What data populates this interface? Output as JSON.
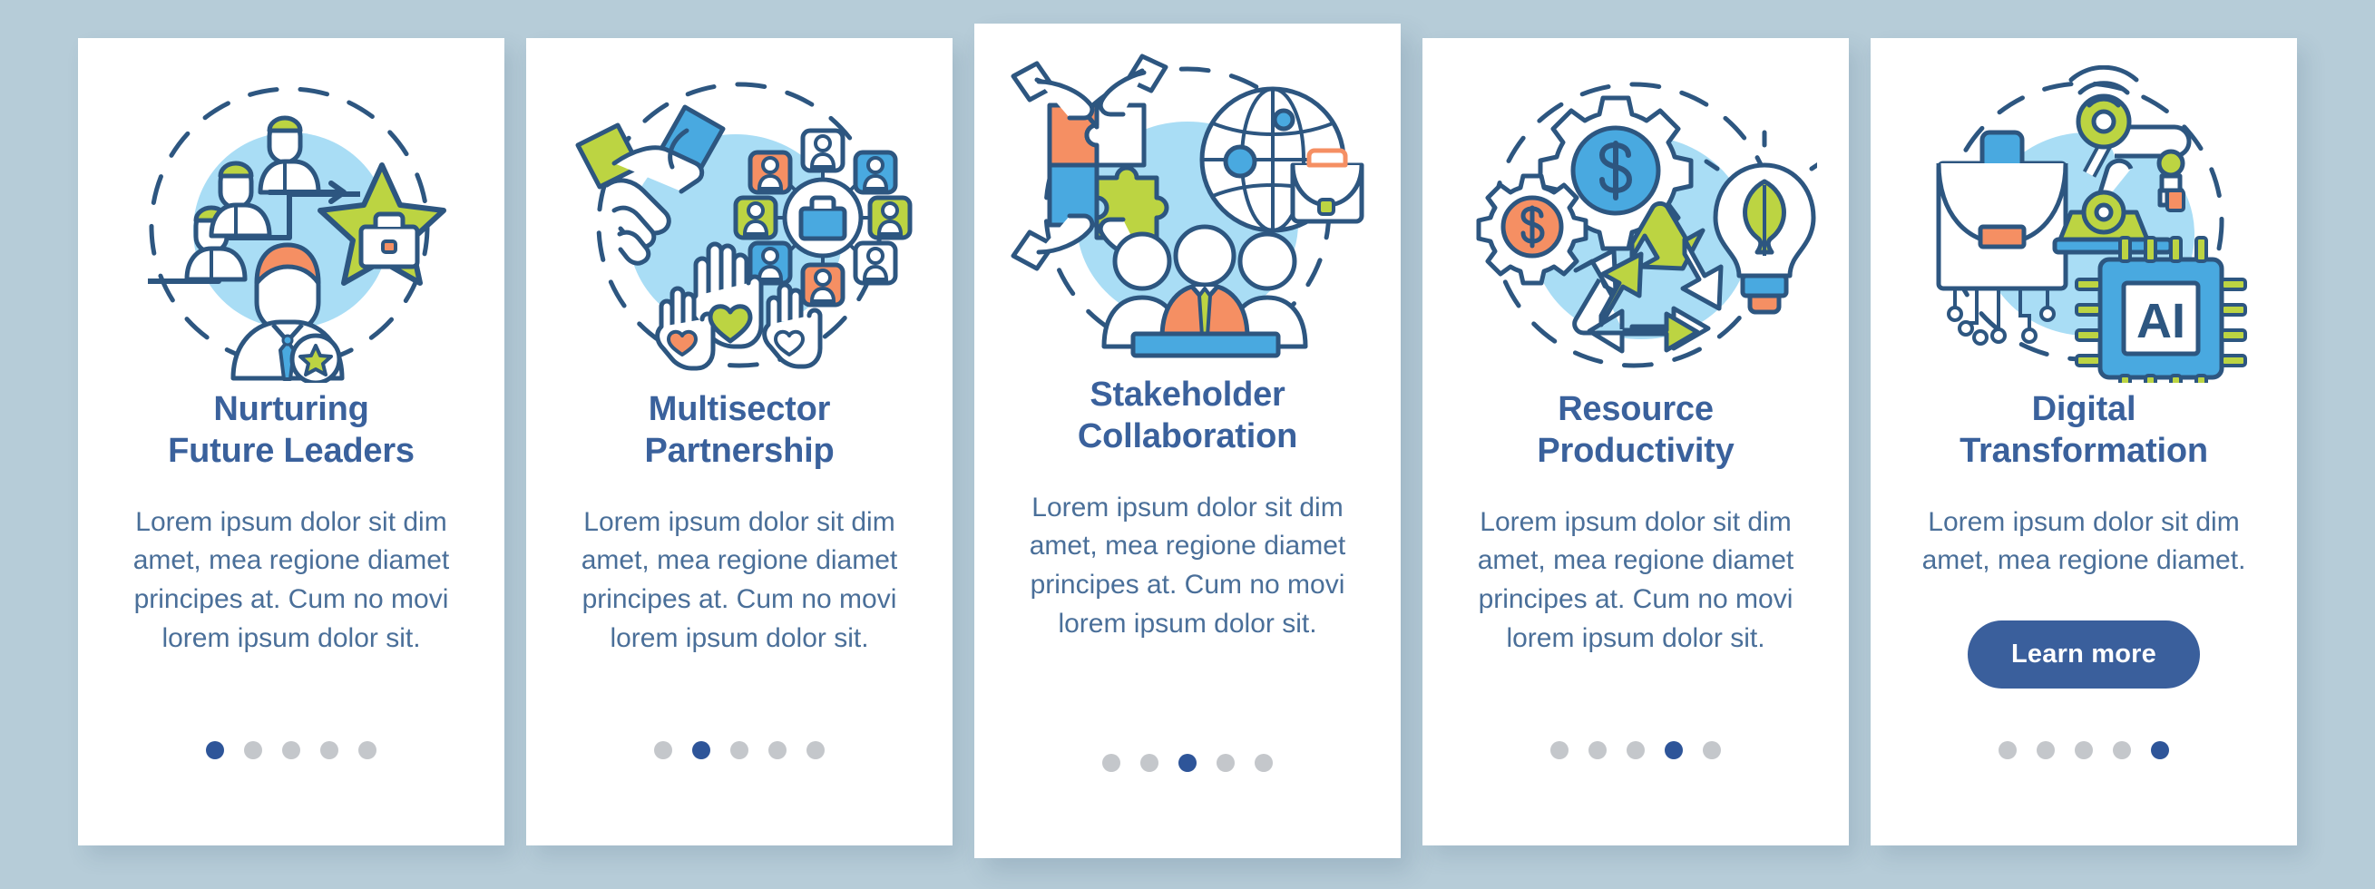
{
  "palette": {
    "page_background": "#b6ccd8",
    "card_background": "#ffffff",
    "title_blue": "#3a619c",
    "body_blue": "#4a6f99",
    "outline_blue": "#2d5680",
    "accent_light_blue": "#a9ddf5",
    "accent_blue": "#49a9e0",
    "accent_olive": "#bcd442",
    "accent_orange": "#f58f63",
    "dot_inactive": "#c4c7cb",
    "dot_active": "#2e5599",
    "button_blue": "#3a5f9c"
  },
  "cards": [
    {
      "id": "nurturing-future-leaders",
      "illustration": "career-growth-leader-icon",
      "title": "Nurturing\nFuture Leaders",
      "body": "Lorem ipsum dolor sit dim amet, mea regione diamet principes at. Cum no movi lorem ipsum dolor sit.",
      "dots": {
        "total": 5,
        "active_index": 0
      },
      "button": null
    },
    {
      "id": "multisector-partnership",
      "illustration": "handshake-network-hands-icon",
      "title": "Multisector\nPartnership",
      "body": "Lorem ipsum dolor sit dim amet, mea regione diamet principes at. Cum no movi lorem ipsum dolor sit.",
      "dots": {
        "total": 5,
        "active_index": 1
      },
      "button": null
    },
    {
      "id": "stakeholder-collaboration",
      "illustration": "puzzle-globe-team-icon",
      "title": "Stakeholder\nCollaboration",
      "body": "Lorem ipsum dolor sit dim amet, mea regione diamet principes at. Cum no movi lorem ipsum dolor sit.",
      "dots": {
        "total": 5,
        "active_index": 2
      },
      "button": null
    },
    {
      "id": "resource-productivity",
      "illustration": "gears-recycle-bulb-icon",
      "title": "Resource\nProductivity",
      "body": "Lorem ipsum dolor sit dim amet, mea regione diamet principes at. Cum no movi lorem ipsum dolor sit.",
      "dots": {
        "total": 5,
        "active_index": 3
      },
      "button": null
    },
    {
      "id": "digital-transformation",
      "illustration": "briefcase-robot-ai-chip-icon",
      "title": "Digital\nTransformation",
      "body": "Lorem ipsum dolor sit dim amet, mea regione diamet.",
      "dots": {
        "total": 5,
        "active_index": 4
      },
      "button": {
        "label": "Learn more"
      }
    }
  ],
  "chip_label": "AI"
}
